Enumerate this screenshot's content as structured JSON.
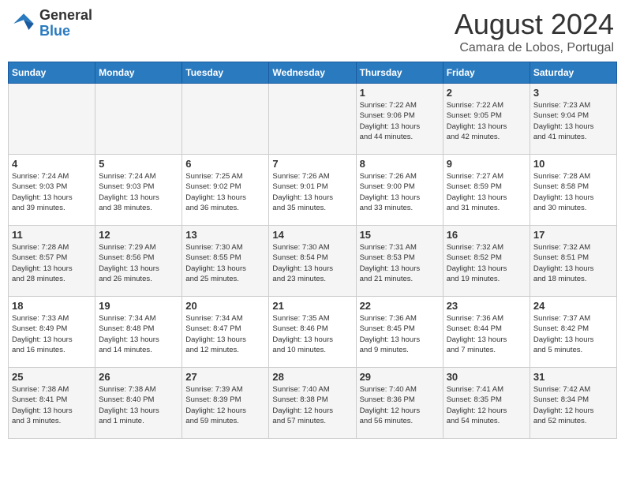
{
  "logo": {
    "general": "General",
    "blue": "Blue"
  },
  "title": "August 2024",
  "subtitle": "Camara de Lobos, Portugal",
  "days_of_week": [
    "Sunday",
    "Monday",
    "Tuesday",
    "Wednesday",
    "Thursday",
    "Friday",
    "Saturday"
  ],
  "weeks": [
    [
      {
        "num": "",
        "info": ""
      },
      {
        "num": "",
        "info": ""
      },
      {
        "num": "",
        "info": ""
      },
      {
        "num": "",
        "info": ""
      },
      {
        "num": "1",
        "info": "Sunrise: 7:22 AM\nSunset: 9:06 PM\nDaylight: 13 hours\nand 44 minutes."
      },
      {
        "num": "2",
        "info": "Sunrise: 7:22 AM\nSunset: 9:05 PM\nDaylight: 13 hours\nand 42 minutes."
      },
      {
        "num": "3",
        "info": "Sunrise: 7:23 AM\nSunset: 9:04 PM\nDaylight: 13 hours\nand 41 minutes."
      }
    ],
    [
      {
        "num": "4",
        "info": "Sunrise: 7:24 AM\nSunset: 9:03 PM\nDaylight: 13 hours\nand 39 minutes."
      },
      {
        "num": "5",
        "info": "Sunrise: 7:24 AM\nSunset: 9:03 PM\nDaylight: 13 hours\nand 38 minutes."
      },
      {
        "num": "6",
        "info": "Sunrise: 7:25 AM\nSunset: 9:02 PM\nDaylight: 13 hours\nand 36 minutes."
      },
      {
        "num": "7",
        "info": "Sunrise: 7:26 AM\nSunset: 9:01 PM\nDaylight: 13 hours\nand 35 minutes."
      },
      {
        "num": "8",
        "info": "Sunrise: 7:26 AM\nSunset: 9:00 PM\nDaylight: 13 hours\nand 33 minutes."
      },
      {
        "num": "9",
        "info": "Sunrise: 7:27 AM\nSunset: 8:59 PM\nDaylight: 13 hours\nand 31 minutes."
      },
      {
        "num": "10",
        "info": "Sunrise: 7:28 AM\nSunset: 8:58 PM\nDaylight: 13 hours\nand 30 minutes."
      }
    ],
    [
      {
        "num": "11",
        "info": "Sunrise: 7:28 AM\nSunset: 8:57 PM\nDaylight: 13 hours\nand 28 minutes."
      },
      {
        "num": "12",
        "info": "Sunrise: 7:29 AM\nSunset: 8:56 PM\nDaylight: 13 hours\nand 26 minutes."
      },
      {
        "num": "13",
        "info": "Sunrise: 7:30 AM\nSunset: 8:55 PM\nDaylight: 13 hours\nand 25 minutes."
      },
      {
        "num": "14",
        "info": "Sunrise: 7:30 AM\nSunset: 8:54 PM\nDaylight: 13 hours\nand 23 minutes."
      },
      {
        "num": "15",
        "info": "Sunrise: 7:31 AM\nSunset: 8:53 PM\nDaylight: 13 hours\nand 21 minutes."
      },
      {
        "num": "16",
        "info": "Sunrise: 7:32 AM\nSunset: 8:52 PM\nDaylight: 13 hours\nand 19 minutes."
      },
      {
        "num": "17",
        "info": "Sunrise: 7:32 AM\nSunset: 8:51 PM\nDaylight: 13 hours\nand 18 minutes."
      }
    ],
    [
      {
        "num": "18",
        "info": "Sunrise: 7:33 AM\nSunset: 8:49 PM\nDaylight: 13 hours\nand 16 minutes."
      },
      {
        "num": "19",
        "info": "Sunrise: 7:34 AM\nSunset: 8:48 PM\nDaylight: 13 hours\nand 14 minutes."
      },
      {
        "num": "20",
        "info": "Sunrise: 7:34 AM\nSunset: 8:47 PM\nDaylight: 13 hours\nand 12 minutes."
      },
      {
        "num": "21",
        "info": "Sunrise: 7:35 AM\nSunset: 8:46 PM\nDaylight: 13 hours\nand 10 minutes."
      },
      {
        "num": "22",
        "info": "Sunrise: 7:36 AM\nSunset: 8:45 PM\nDaylight: 13 hours\nand 9 minutes."
      },
      {
        "num": "23",
        "info": "Sunrise: 7:36 AM\nSunset: 8:44 PM\nDaylight: 13 hours\nand 7 minutes."
      },
      {
        "num": "24",
        "info": "Sunrise: 7:37 AM\nSunset: 8:42 PM\nDaylight: 13 hours\nand 5 minutes."
      }
    ],
    [
      {
        "num": "25",
        "info": "Sunrise: 7:38 AM\nSunset: 8:41 PM\nDaylight: 13 hours\nand 3 minutes."
      },
      {
        "num": "26",
        "info": "Sunrise: 7:38 AM\nSunset: 8:40 PM\nDaylight: 13 hours\nand 1 minute."
      },
      {
        "num": "27",
        "info": "Sunrise: 7:39 AM\nSunset: 8:39 PM\nDaylight: 12 hours\nand 59 minutes."
      },
      {
        "num": "28",
        "info": "Sunrise: 7:40 AM\nSunset: 8:38 PM\nDaylight: 12 hours\nand 57 minutes."
      },
      {
        "num": "29",
        "info": "Sunrise: 7:40 AM\nSunset: 8:36 PM\nDaylight: 12 hours\nand 56 minutes."
      },
      {
        "num": "30",
        "info": "Sunrise: 7:41 AM\nSunset: 8:35 PM\nDaylight: 12 hours\nand 54 minutes."
      },
      {
        "num": "31",
        "info": "Sunrise: 7:42 AM\nSunset: 8:34 PM\nDaylight: 12 hours\nand 52 minutes."
      }
    ]
  ]
}
